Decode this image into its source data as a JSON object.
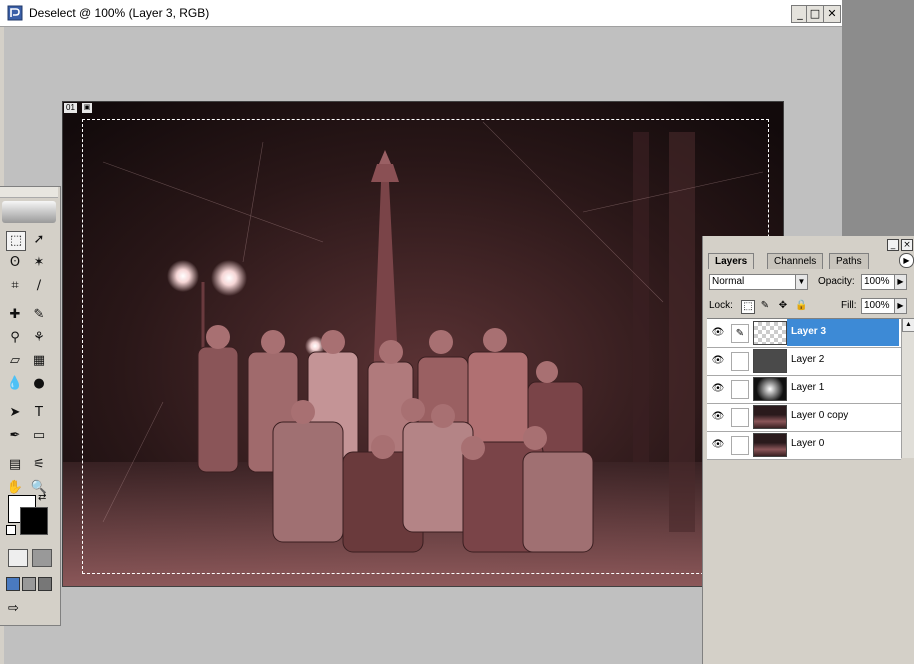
{
  "window": {
    "title": "Deselect @ 100% (Layer 3, RGB)",
    "minimize": "_",
    "maximize": "□",
    "close": "✕"
  },
  "canvas": {
    "tag": "01",
    "tag_icon": "canvas-options-icon",
    "image": "night group photo in front of monument, red sepia tint"
  },
  "toolbox": {
    "tools": [
      {
        "name": "rectangular-marquee-icon",
        "glyph": "⬚"
      },
      {
        "name": "move-icon",
        "glyph": "➚"
      },
      {
        "name": "lasso-icon",
        "glyph": "ʘ"
      },
      {
        "name": "magic-wand-icon",
        "glyph": "✶"
      },
      {
        "name": "crop-icon",
        "glyph": "⌗"
      },
      {
        "name": "slice-icon",
        "glyph": "∕"
      },
      {
        "name": "healing-brush-icon",
        "glyph": "✚"
      },
      {
        "name": "brush-icon",
        "glyph": "✎"
      },
      {
        "name": "clone-stamp-icon",
        "glyph": "⚲"
      },
      {
        "name": "history-brush-icon",
        "glyph": "⚘"
      },
      {
        "name": "eraser-icon",
        "glyph": "▱"
      },
      {
        "name": "gradient-icon",
        "glyph": "▦"
      },
      {
        "name": "blur-icon",
        "glyph": "💧"
      },
      {
        "name": "dodge-icon",
        "glyph": "●"
      },
      {
        "name": "path-selection-icon",
        "glyph": "➤"
      },
      {
        "name": "type-icon",
        "glyph": "T"
      },
      {
        "name": "pen-icon",
        "glyph": "✒"
      },
      {
        "name": "shape-icon",
        "glyph": "▭"
      },
      {
        "name": "notes-icon",
        "glyph": "▤"
      },
      {
        "name": "eyedropper-icon",
        "glyph": "⚟"
      },
      {
        "name": "hand-icon",
        "glyph": "✋"
      },
      {
        "name": "zoom-icon",
        "glyph": "🔍"
      }
    ],
    "foreground_color": "#ffffff",
    "background_color": "#000000"
  },
  "layers_panel": {
    "tabs": [
      "Layers",
      "Channels",
      "Paths"
    ],
    "blend_mode": "Normal",
    "opacity_label": "Opacity:",
    "opacity_value": "100%",
    "lock_label": "Lock:",
    "fill_label": "Fill:",
    "fill_value": "100%",
    "layers": [
      {
        "name": "Layer 3",
        "selected": true,
        "thumb": "transparent"
      },
      {
        "name": "Layer 2",
        "selected": false,
        "thumb": "dark-gray"
      },
      {
        "name": "Layer 1",
        "selected": false,
        "thumb": "radial-white"
      },
      {
        "name": "Layer 0 copy",
        "selected": false,
        "thumb": "photo"
      },
      {
        "name": "Layer 0",
        "selected": false,
        "thumb": "photo"
      }
    ],
    "accent_color": "#3d8ad6"
  }
}
